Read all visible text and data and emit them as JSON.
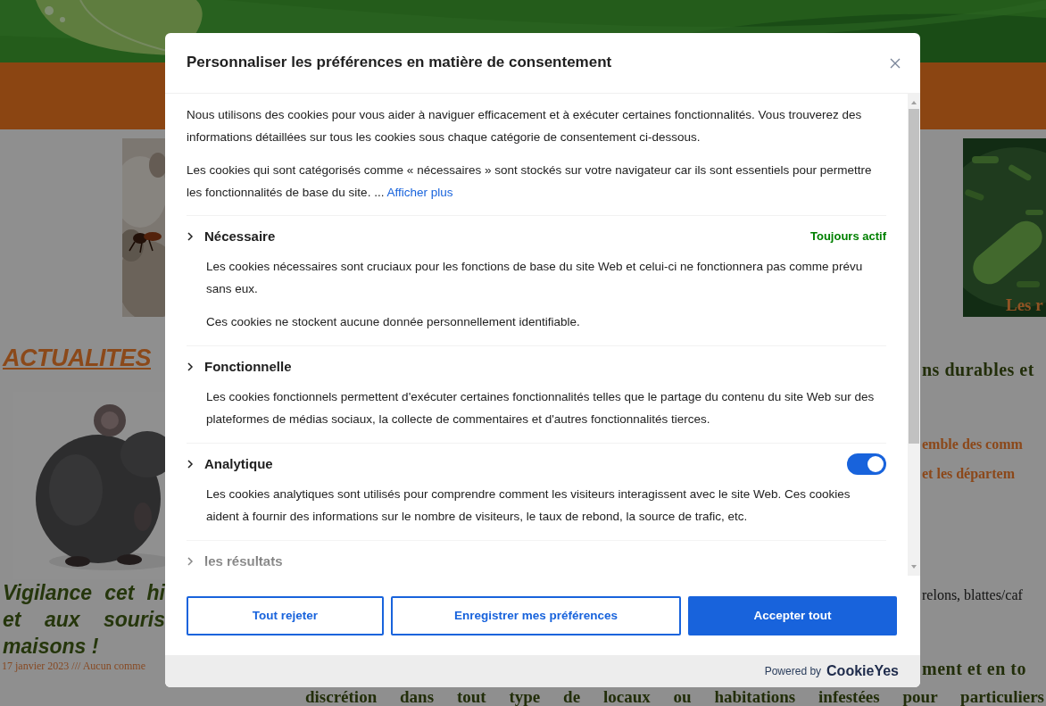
{
  "site": {
    "left_column": {
      "section_title": "ACTUALITES",
      "post_title_lines": [
        "Vigilance cet hi",
        "et aux souris",
        "maisons !"
      ],
      "post_meta": "17 janvier 2023 /// Aucun comme"
    },
    "right_column": {
      "image_caption": "Les r",
      "text_fragments": [
        {
          "text": "ns durables et",
          "kind": "heading"
        },
        {
          "text": "emble des comm",
          "kind": "accent"
        },
        {
          "text": "et les départem",
          "kind": "accent"
        },
        {
          "text": "relons, blattes/caf",
          "kind": "body"
        },
        {
          "text": "ment et en to",
          "kind": "heading"
        }
      ]
    },
    "bottom_line": "discrétion dans tout type de locaux ou habitations infestées pour particuliers"
  },
  "consent_dialog": {
    "title": "Personnaliser les préférences en matière de consentement",
    "intro": [
      "Nous utilisons des cookies pour vous aider à naviguer efficacement et à exécuter certaines fonctionnalités. Vous trouverez des informations détaillées sur tous les cookies sous chaque catégorie de consentement ci-dessous.",
      "Les cookies qui sont catégorisés comme « nécessaires » sont stockés sur votre navigateur car ils sont essentiels pour permettre les fonctionnalités de base du site. ..."
    ],
    "show_more": "Afficher plus",
    "categories": [
      {
        "title": "Nécessaire",
        "kind": "always",
        "status": "Toujours actif",
        "descriptions": [
          "Les cookies nécessaires sont cruciaux pour les fonctions de base du site Web et celui-ci ne fonctionnera pas comme prévu sans eux.",
          "Ces cookies ne stockent aucune donnée personnellement identifiable."
        ]
      },
      {
        "title": "Fonctionnelle",
        "kind": "plain",
        "descriptions": [
          "Les cookies fonctionnels permettent d'exécuter certaines fonctionnalités telles que le partage du contenu du site Web sur des plateformes de médias sociaux, la collecte de commentaires et d'autres fonctionnalités tierces."
        ]
      },
      {
        "title": "Analytique",
        "kind": "toggle",
        "on": true,
        "descriptions": [
          "Les cookies analytiques sont utilisés pour comprendre comment les visiteurs interagissent avec le site Web. Ces cookies aident à fournir des informations sur le nombre de visiteurs, le taux de rebond, la source de trafic, etc."
        ]
      },
      {
        "title": "les résultats",
        "kind": "plain"
      }
    ],
    "buttons": [
      {
        "label": "Tout rejeter",
        "kind": "outline"
      },
      {
        "label": "Enregistrer mes préférences",
        "kind": "outline"
      },
      {
        "label": "Accepter tout",
        "kind": "primary"
      }
    ],
    "powered_by": "Powered by",
    "brand": "CookieYes"
  }
}
